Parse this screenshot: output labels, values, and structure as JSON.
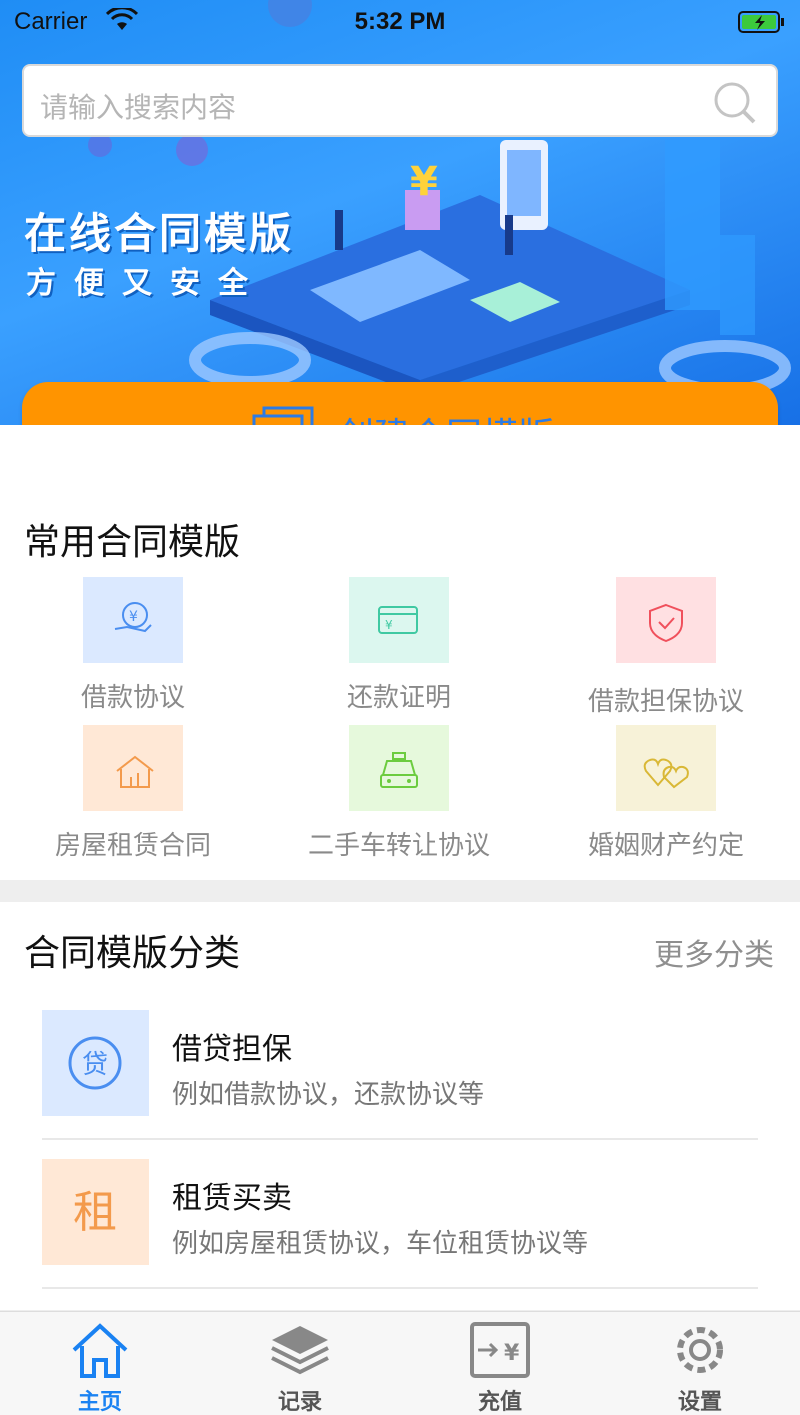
{
  "status_bar": {
    "carrier": "Carrier",
    "time": "5:32 PM"
  },
  "search": {
    "placeholder": "请输入搜索内容"
  },
  "banner": {
    "title": "在线合同模版",
    "subtitle": "方便又安全"
  },
  "create_button": {
    "label": "创建合同模版"
  },
  "common": {
    "title": "常用合同模版",
    "items": [
      {
        "label": "借款协议",
        "icon": "loan-icon",
        "bg": "#dbe9ff",
        "color": "#4a8ef0"
      },
      {
        "label": "还款证明",
        "icon": "repayment-card-icon",
        "bg": "#dcf7ef",
        "color": "#3fc9a2"
      },
      {
        "label": "借款担保协议",
        "icon": "shield-check-icon",
        "bg": "#ffe0e2",
        "color": "#f0505c"
      },
      {
        "label": "房屋租赁合同",
        "icon": "house-icon",
        "bg": "#ffe8d6",
        "color": "#f39a4c"
      },
      {
        "label": "二手车转让协议",
        "icon": "car-icon",
        "bg": "#e6f9dc",
        "color": "#6ccc3f"
      },
      {
        "label": "婚姻财产约定",
        "icon": "hearts-icon",
        "bg": "#f7f2d8",
        "color": "#d9b836"
      }
    ]
  },
  "categories": {
    "title": "合同模版分类",
    "more": "更多分类",
    "items": [
      {
        "title": "借贷担保",
        "desc": "例如借款协议，还款协议等",
        "glyph": "贷",
        "bg": "#dbe9ff",
        "color": "#4a8ef0"
      },
      {
        "title": "租赁买卖",
        "desc": "例如房屋租赁协议，车位租赁协议等",
        "glyph": "租",
        "bg": "#ffe8d6",
        "color": "#f39a4c"
      }
    ]
  },
  "tabbar": {
    "items": [
      {
        "label": "主页",
        "icon": "home-icon",
        "active": true
      },
      {
        "label": "记录",
        "icon": "layers-icon",
        "active": false
      },
      {
        "label": "充值",
        "icon": "recharge-icon",
        "active": false
      },
      {
        "label": "设置",
        "icon": "gear-icon",
        "active": false
      }
    ]
  },
  "colors": {
    "accent": "#1a82f2",
    "orange": "#ff9400",
    "banner": "#2d94f8"
  }
}
